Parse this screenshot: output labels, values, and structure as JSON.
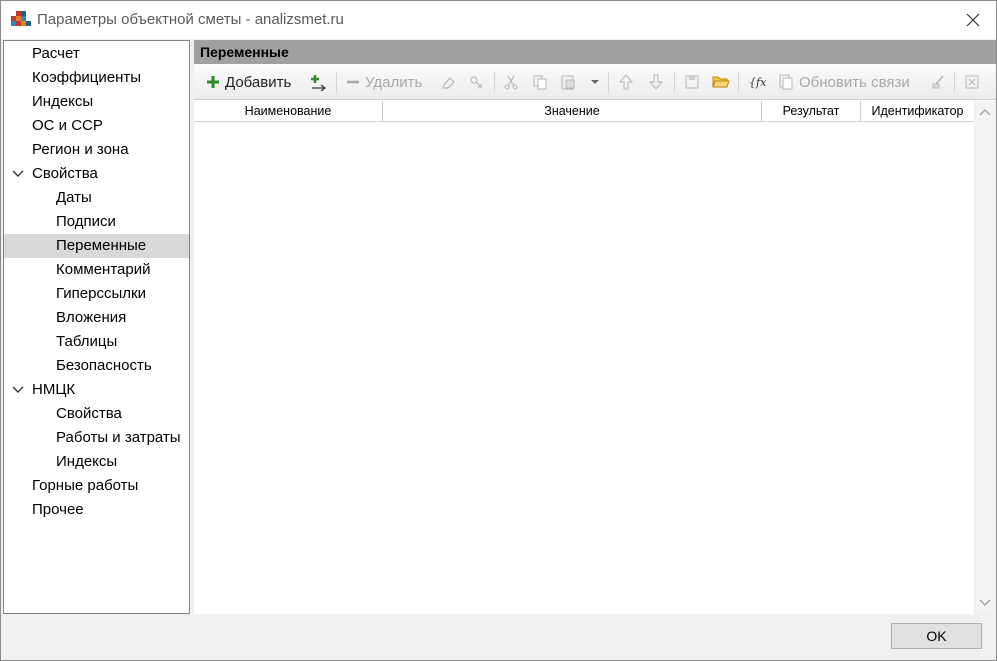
{
  "window": {
    "title": "Параметры объектной сметы - analizsmet.ru",
    "app_icon": "grid-app-icon",
    "close_icon": "close-icon"
  },
  "tree": {
    "items": [
      {
        "label": "Расчет",
        "level": 0
      },
      {
        "label": "Коэффициенты",
        "level": 0
      },
      {
        "label": "Индексы",
        "level": 0
      },
      {
        "label": "ОС и ССР",
        "level": 0
      },
      {
        "label": "Регион и зона",
        "level": 0
      },
      {
        "label": "Свойства",
        "level": 0,
        "expanded": true
      },
      {
        "label": "Даты",
        "level": 1
      },
      {
        "label": "Подписи",
        "level": 1
      },
      {
        "label": "Переменные",
        "level": 1,
        "selected": true
      },
      {
        "label": "Комментарий",
        "level": 1
      },
      {
        "label": "Гиперссылки",
        "level": 1
      },
      {
        "label": "Вложения",
        "level": 1
      },
      {
        "label": "Таблицы",
        "level": 1
      },
      {
        "label": "Безопасность",
        "level": 1
      },
      {
        "label": "НМЦК",
        "level": 0,
        "expanded": true
      },
      {
        "label": "Свойства",
        "level": 1
      },
      {
        "label": "Работы и затраты",
        "level": 1
      },
      {
        "label": "Индексы",
        "level": 1
      },
      {
        "label": "Горные работы",
        "level": 0
      },
      {
        "label": "Прочее",
        "level": 0
      }
    ]
  },
  "panel": {
    "header": "Переменные",
    "toolbar": {
      "add_label": "Добавить",
      "delete_label": "Удалить",
      "refresh_links_label": "Обновить связи"
    },
    "columns": [
      "Наименование",
      "Значение",
      "Результат",
      "Идентификатор"
    ],
    "rows": []
  },
  "footer": {
    "ok_label": "OK"
  },
  "colors": {
    "accent_green": "#2e8b2e",
    "panel_header_bg": "#a0a0a0",
    "selected_bg": "#d9d9d9"
  }
}
